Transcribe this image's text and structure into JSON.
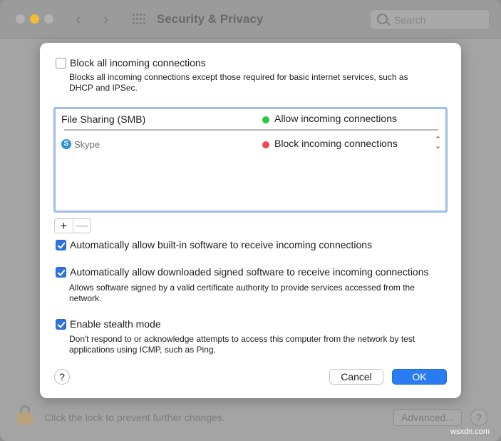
{
  "window": {
    "title": "Security & Privacy",
    "search_placeholder": "Search",
    "footer_text": "Click the lock to prevent further changes.",
    "advanced_label": "Advanced...",
    "help_label": "?"
  },
  "sheet": {
    "block_all": {
      "label": "Block all incoming connections",
      "checked": false,
      "description": "Blocks all incoming connections except those required for basic internet services, such as DHCP and IPSec."
    },
    "apps": [
      {
        "name": "File Sharing (SMB)",
        "status": "Allow incoming connections",
        "status_color": "#28c840",
        "icon": ""
      },
      {
        "name": "Skype",
        "status": "Block incoming connections",
        "status_color": "#ec4b4b",
        "icon": "skype-icon"
      }
    ],
    "add_label": "+",
    "remove_label": "—",
    "auto_builtin": {
      "label": "Automatically allow built-in software to receive incoming connections",
      "checked": true
    },
    "auto_signed": {
      "label": "Automatically allow downloaded signed software to receive incoming connections",
      "checked": true,
      "description": "Allows software signed by a valid certificate authority to provide services accessed from the network."
    },
    "stealth": {
      "label": "Enable stealth mode",
      "checked": true,
      "description": "Don't respond to or acknowledge attempts to access this computer from the network by test applications using ICMP, such as Ping."
    },
    "help_label": "?",
    "cancel_label": "Cancel",
    "ok_label": "OK"
  },
  "watermark": "wsxdn.com",
  "colors": {
    "accent": "#2b7cf2",
    "allow": "#28c840",
    "block": "#ec4b4b"
  }
}
